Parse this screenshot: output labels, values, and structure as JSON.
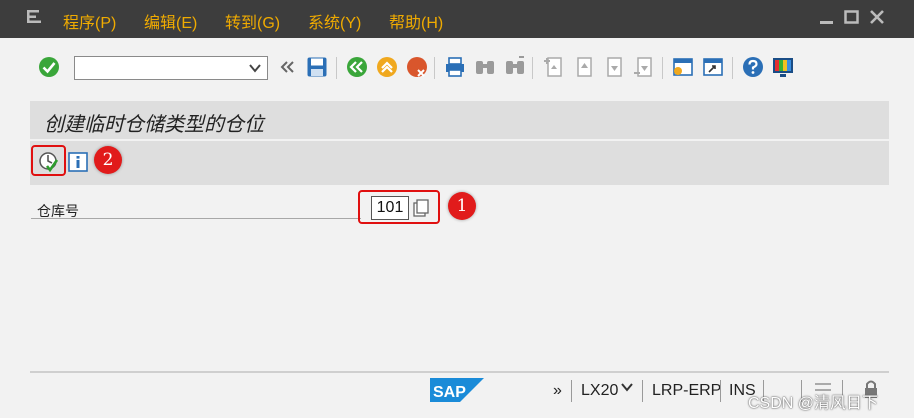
{
  "menu": {
    "items": [
      "程序(P)",
      "编辑(E)",
      "转到(G)",
      "系统(Y)",
      "帮助(H)"
    ]
  },
  "toolbar": {
    "command_field": {
      "value": "",
      "placeholder": ""
    },
    "icons": [
      "enter-check-icon",
      "command-dropdown-icon",
      "double-chevron-left-icon",
      "save-icon",
      "back-icon",
      "exit-icon",
      "cancel-icon",
      "print-icon",
      "find-icon",
      "find-next-icon",
      "first-page-icon",
      "previous-page-icon",
      "next-page-icon",
      "last-page-icon",
      "new-session-icon",
      "shortcut-icon",
      "help-icon",
      "customize-layout-icon"
    ]
  },
  "screen": {
    "title": "创建临时仓储类型的仓位"
  },
  "app_toolbar": {
    "icons": [
      "execute-icon",
      "info-icon"
    ]
  },
  "form": {
    "warehouse_label": "仓库号",
    "warehouse_value": "101"
  },
  "callouts": {
    "one": "1",
    "two": "2"
  },
  "statusbar": {
    "arrows": "»",
    "transaction": "LX20",
    "system": "LRP-ERP",
    "mode": "INS"
  },
  "watermark": "CSDN @清风日下",
  "colors": {
    "menubar_bg": "#3d3d3d",
    "menu_text": "#f0ab00",
    "callout_red": "#e11b1b",
    "sap_blue": "#1a8bd8"
  }
}
